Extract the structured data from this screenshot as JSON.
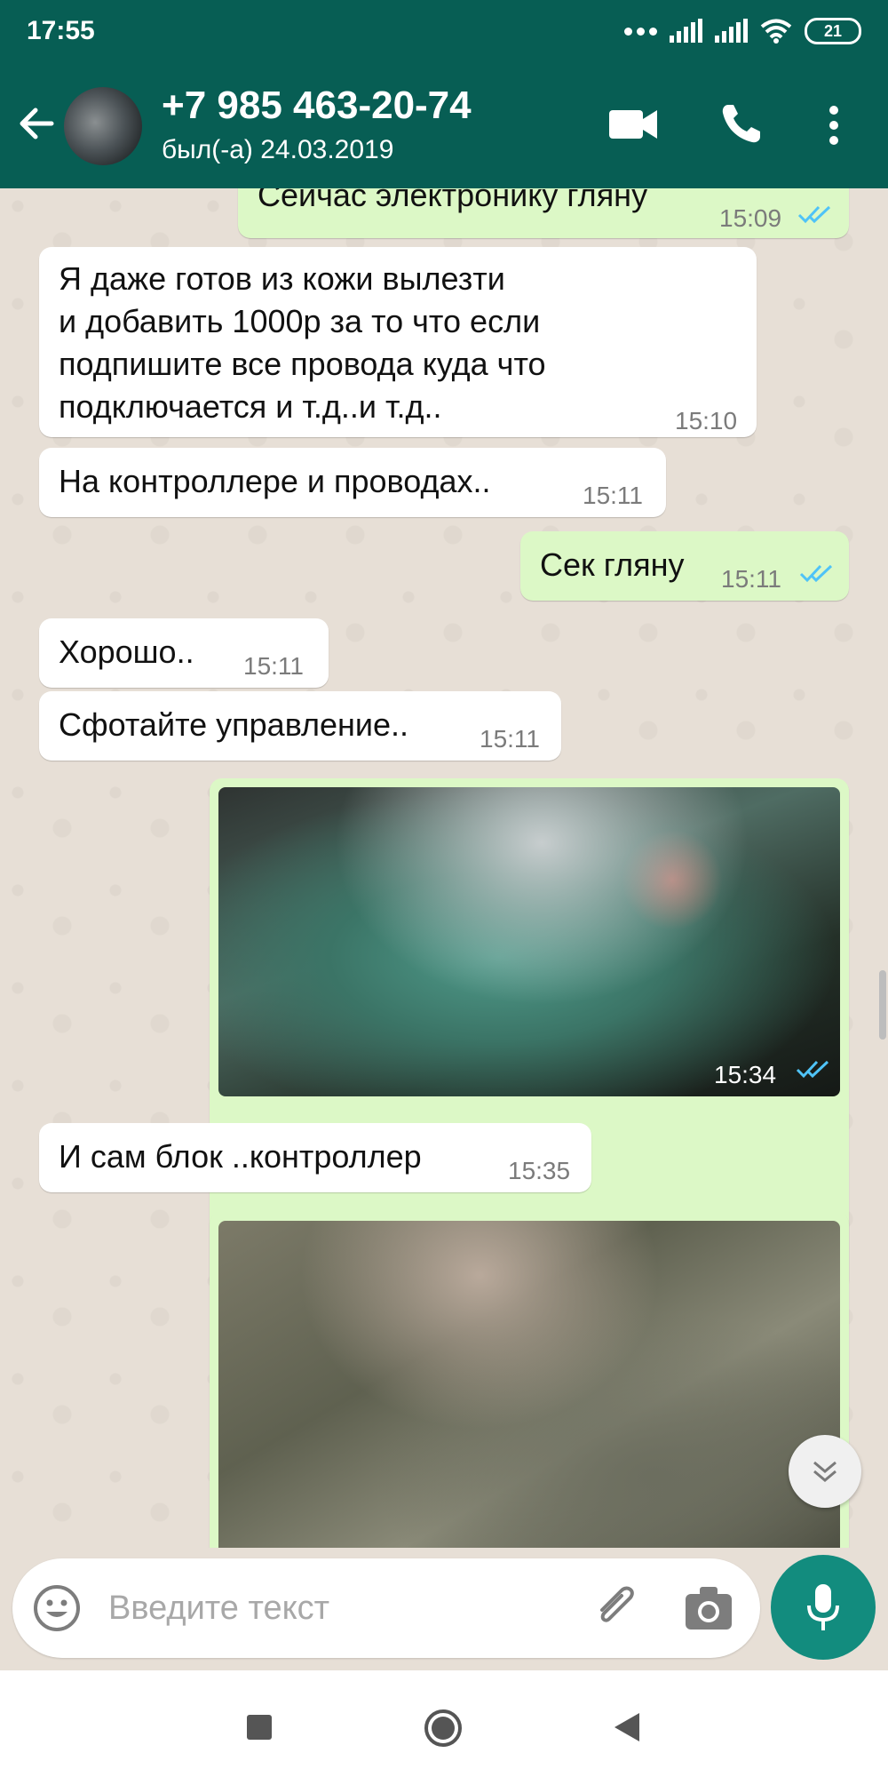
{
  "status_bar": {
    "time": "17:55",
    "battery": "21"
  },
  "header": {
    "contact_name": "+7 985 463-20-74",
    "last_seen": "был(-а) 24.03.2019"
  },
  "messages": [
    {
      "direction": "out",
      "text": "Сейчас электронику гляну",
      "time": "15:09",
      "read": true
    },
    {
      "direction": "in",
      "text": "Я даже готов из кожи вылезти\nи добавить 1000р за то что если\nподпишите все провода куда что\nподключается и т.д..и т.д..",
      "time": "15:10"
    },
    {
      "direction": "in",
      "text": "На контроллере и проводах..",
      "time": "15:11"
    },
    {
      "direction": "out",
      "text": "Сек гляну",
      "time": "15:11",
      "read": true
    },
    {
      "direction": "in",
      "text": "Хорошо..",
      "time": "15:11"
    },
    {
      "direction": "in",
      "text": "Сфотайте управление..",
      "time": "15:11"
    },
    {
      "direction": "out",
      "type": "photo",
      "time": "15:34",
      "read": true
    },
    {
      "direction": "in",
      "text": "И сам блок ..контроллер",
      "time": "15:35"
    },
    {
      "direction": "out",
      "type": "photo",
      "time": ""
    }
  ],
  "composer": {
    "placeholder": "Введите текст",
    "value": ""
  },
  "colors": {
    "header": "#075e54",
    "incoming_bubble": "#ffffff",
    "outgoing_bubble": "#dcf8c6",
    "read_ticks": "#4fc3f7",
    "fab": "#128c7e"
  },
  "icons": [
    "back-arrow-icon",
    "video-call-icon",
    "phone-icon",
    "more-vert-icon",
    "emoji-icon",
    "attach-icon",
    "camera-icon",
    "mic-icon",
    "scroll-down-icon",
    "nav-recents-icon",
    "nav-home-icon",
    "nav-back-icon"
  ]
}
